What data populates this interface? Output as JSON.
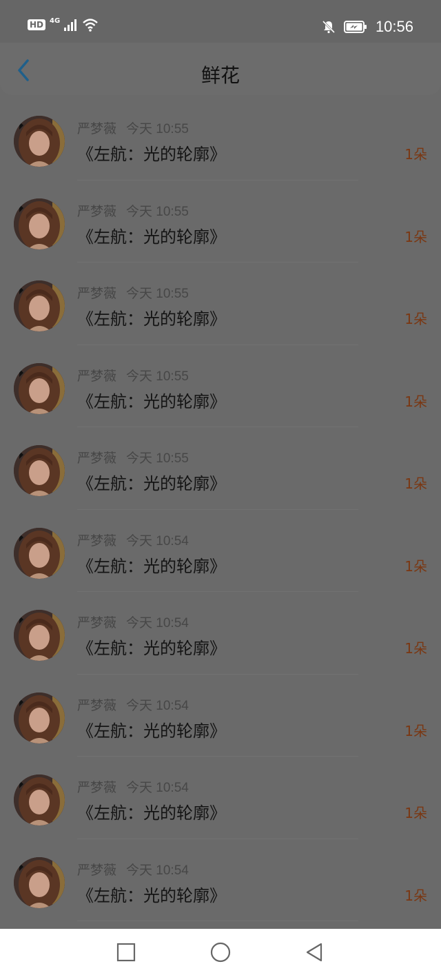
{
  "status": {
    "hd_label": "HD",
    "network_label": "4G",
    "time": "10:56"
  },
  "header": {
    "title": "鲜花"
  },
  "records": [
    {
      "user": "严梦薇",
      "time": "今天 10:55",
      "book": "《左航：光的轮廓》",
      "count": "1朵"
    },
    {
      "user": "严梦薇",
      "time": "今天 10:55",
      "book": "《左航：光的轮廓》",
      "count": "1朵"
    },
    {
      "user": "严梦薇",
      "time": "今天 10:55",
      "book": "《左航：光的轮廓》",
      "count": "1朵"
    },
    {
      "user": "严梦薇",
      "time": "今天 10:55",
      "book": "《左航：光的轮廓》",
      "count": "1朵"
    },
    {
      "user": "严梦薇",
      "time": "今天 10:55",
      "book": "《左航：光的轮廓》",
      "count": "1朵"
    },
    {
      "user": "严梦薇",
      "time": "今天 10:54",
      "book": "《左航：光的轮廓》",
      "count": "1朵"
    },
    {
      "user": "严梦薇",
      "time": "今天 10:54",
      "book": "《左航：光的轮廓》",
      "count": "1朵"
    },
    {
      "user": "严梦薇",
      "time": "今天 10:54",
      "book": "《左航：光的轮廓》",
      "count": "1朵"
    },
    {
      "user": "严梦薇",
      "time": "今天 10:54",
      "book": "《左航：光的轮廓》",
      "count": "1朵"
    },
    {
      "user": "严梦薇",
      "time": "今天 10:54",
      "book": "《左航：光的轮廓》",
      "count": "1朵"
    }
  ],
  "colors": {
    "accent_back": "#1f5f8a",
    "count_text": "#7a3712"
  },
  "icons": {
    "back": "chevron-left-icon",
    "nav_recent": "square-icon",
    "nav_home": "circle-icon",
    "nav_back": "triangle-back-icon"
  }
}
